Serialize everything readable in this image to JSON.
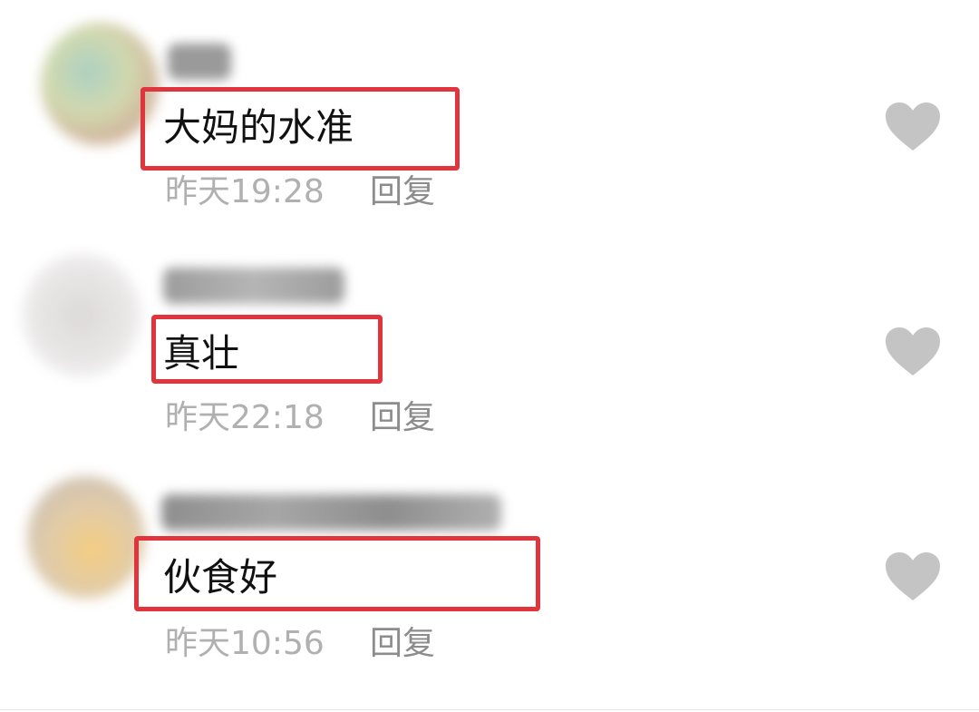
{
  "comments": [
    {
      "text": "大妈的水准",
      "time": "昨天19:28",
      "reply_label": "回复",
      "like_icon": "heart-icon"
    },
    {
      "text": "真壮",
      "time": "昨天22:18",
      "reply_label": "回复",
      "like_icon": "heart-icon"
    },
    {
      "text": "伙食好",
      "time": "昨天10:56",
      "reply_label": "回复",
      "like_icon": "heart-icon"
    }
  ],
  "colors": {
    "highlight_box": "#e0353d",
    "timestamp": "#b0b0b0",
    "reply": "#8c8c8c",
    "heart": "#c4c4c4"
  }
}
